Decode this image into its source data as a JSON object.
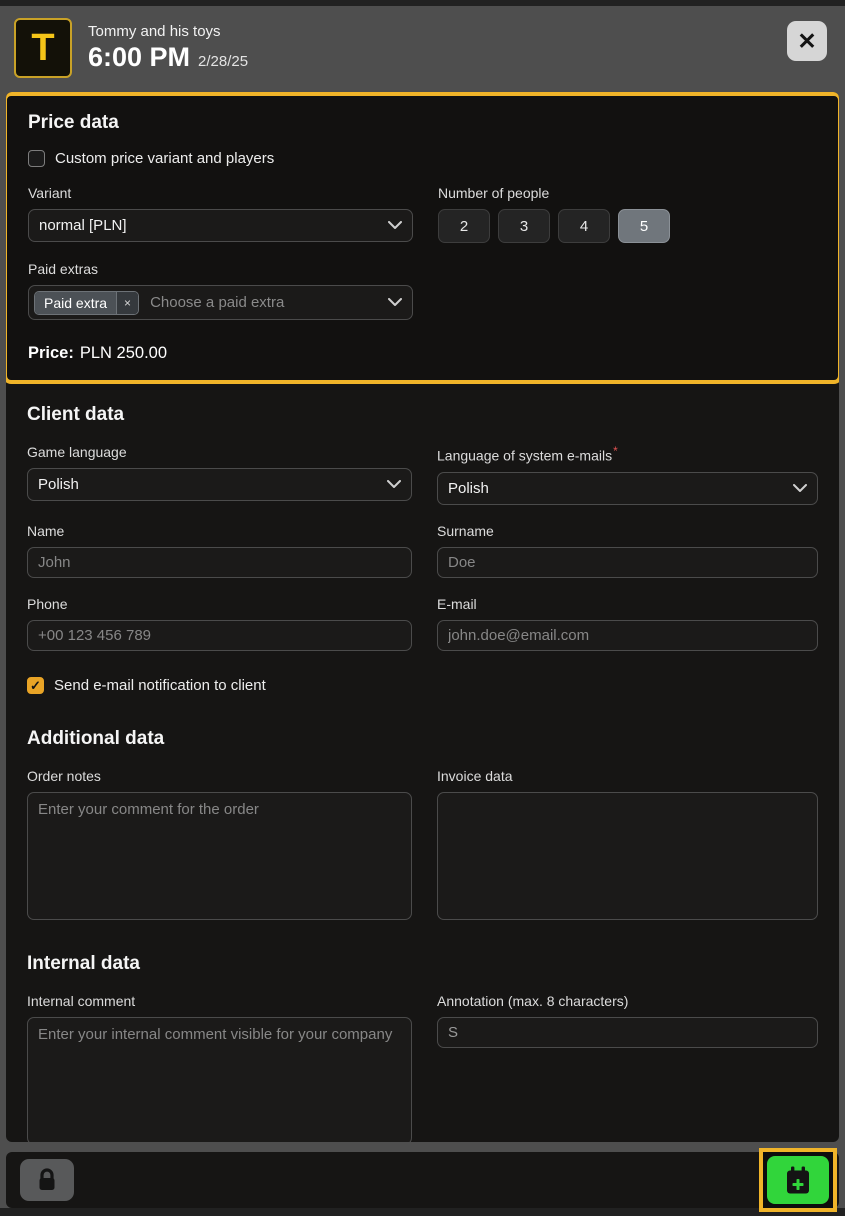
{
  "header": {
    "logo_letter": "T",
    "title": "Tommy and his toys",
    "time": "6:00 PM",
    "date": "2/28/25",
    "close_glyph": "✕"
  },
  "price": {
    "heading": "Price data",
    "custom_checkbox_label": "Custom price variant and players",
    "custom_checkbox_checked": false,
    "variant_label": "Variant",
    "variant_value": "normal [PLN]",
    "people_label": "Number of people",
    "people_options": [
      "2",
      "3",
      "4",
      "5"
    ],
    "people_selected": "5",
    "paid_extras_label": "Paid extras",
    "paid_extra_tag": "Paid extra",
    "paid_extra_remove_glyph": "×",
    "paid_extras_placeholder": "Choose a paid extra",
    "price_label": "Price:",
    "price_value": "PLN 250.00"
  },
  "client": {
    "heading": "Client data",
    "game_language_label": "Game language",
    "game_language_value": "Polish",
    "system_email_language_label": "Language of system e-mails",
    "required_marker": "*",
    "system_email_language_value": "Polish",
    "name_label": "Name",
    "name_placeholder": "John",
    "surname_label": "Surname",
    "surname_placeholder": "Doe",
    "phone_label": "Phone",
    "phone_placeholder": "+00 123 456 789",
    "email_label": "E-mail",
    "email_placeholder": "john.doe@email.com",
    "notify_checkbox_label": "Send e-mail notification to client",
    "notify_checkbox_checked": true,
    "check_glyph": "✓"
  },
  "additional": {
    "heading": "Additional data",
    "order_notes_label": "Order notes",
    "order_notes_placeholder": "Enter your comment for the order",
    "invoice_label": "Invoice data"
  },
  "internal": {
    "heading": "Internal data",
    "comment_label": "Internal comment",
    "comment_placeholder": "Enter your internal comment visible for your company",
    "annotation_label": "Annotation (max. 8 characters)",
    "annotation_value": "S"
  },
  "footer": {
    "lock_icon": "lock",
    "add_booking_icon": "calendar-plus"
  },
  "colors": {
    "highlight_yellow": "#f0b429",
    "accent_green": "#31d53b",
    "checkbox_checked": "#e9a426",
    "required_red": "#e05252",
    "header_gray": "#4e4e4e",
    "panel_dark": "#161514"
  }
}
